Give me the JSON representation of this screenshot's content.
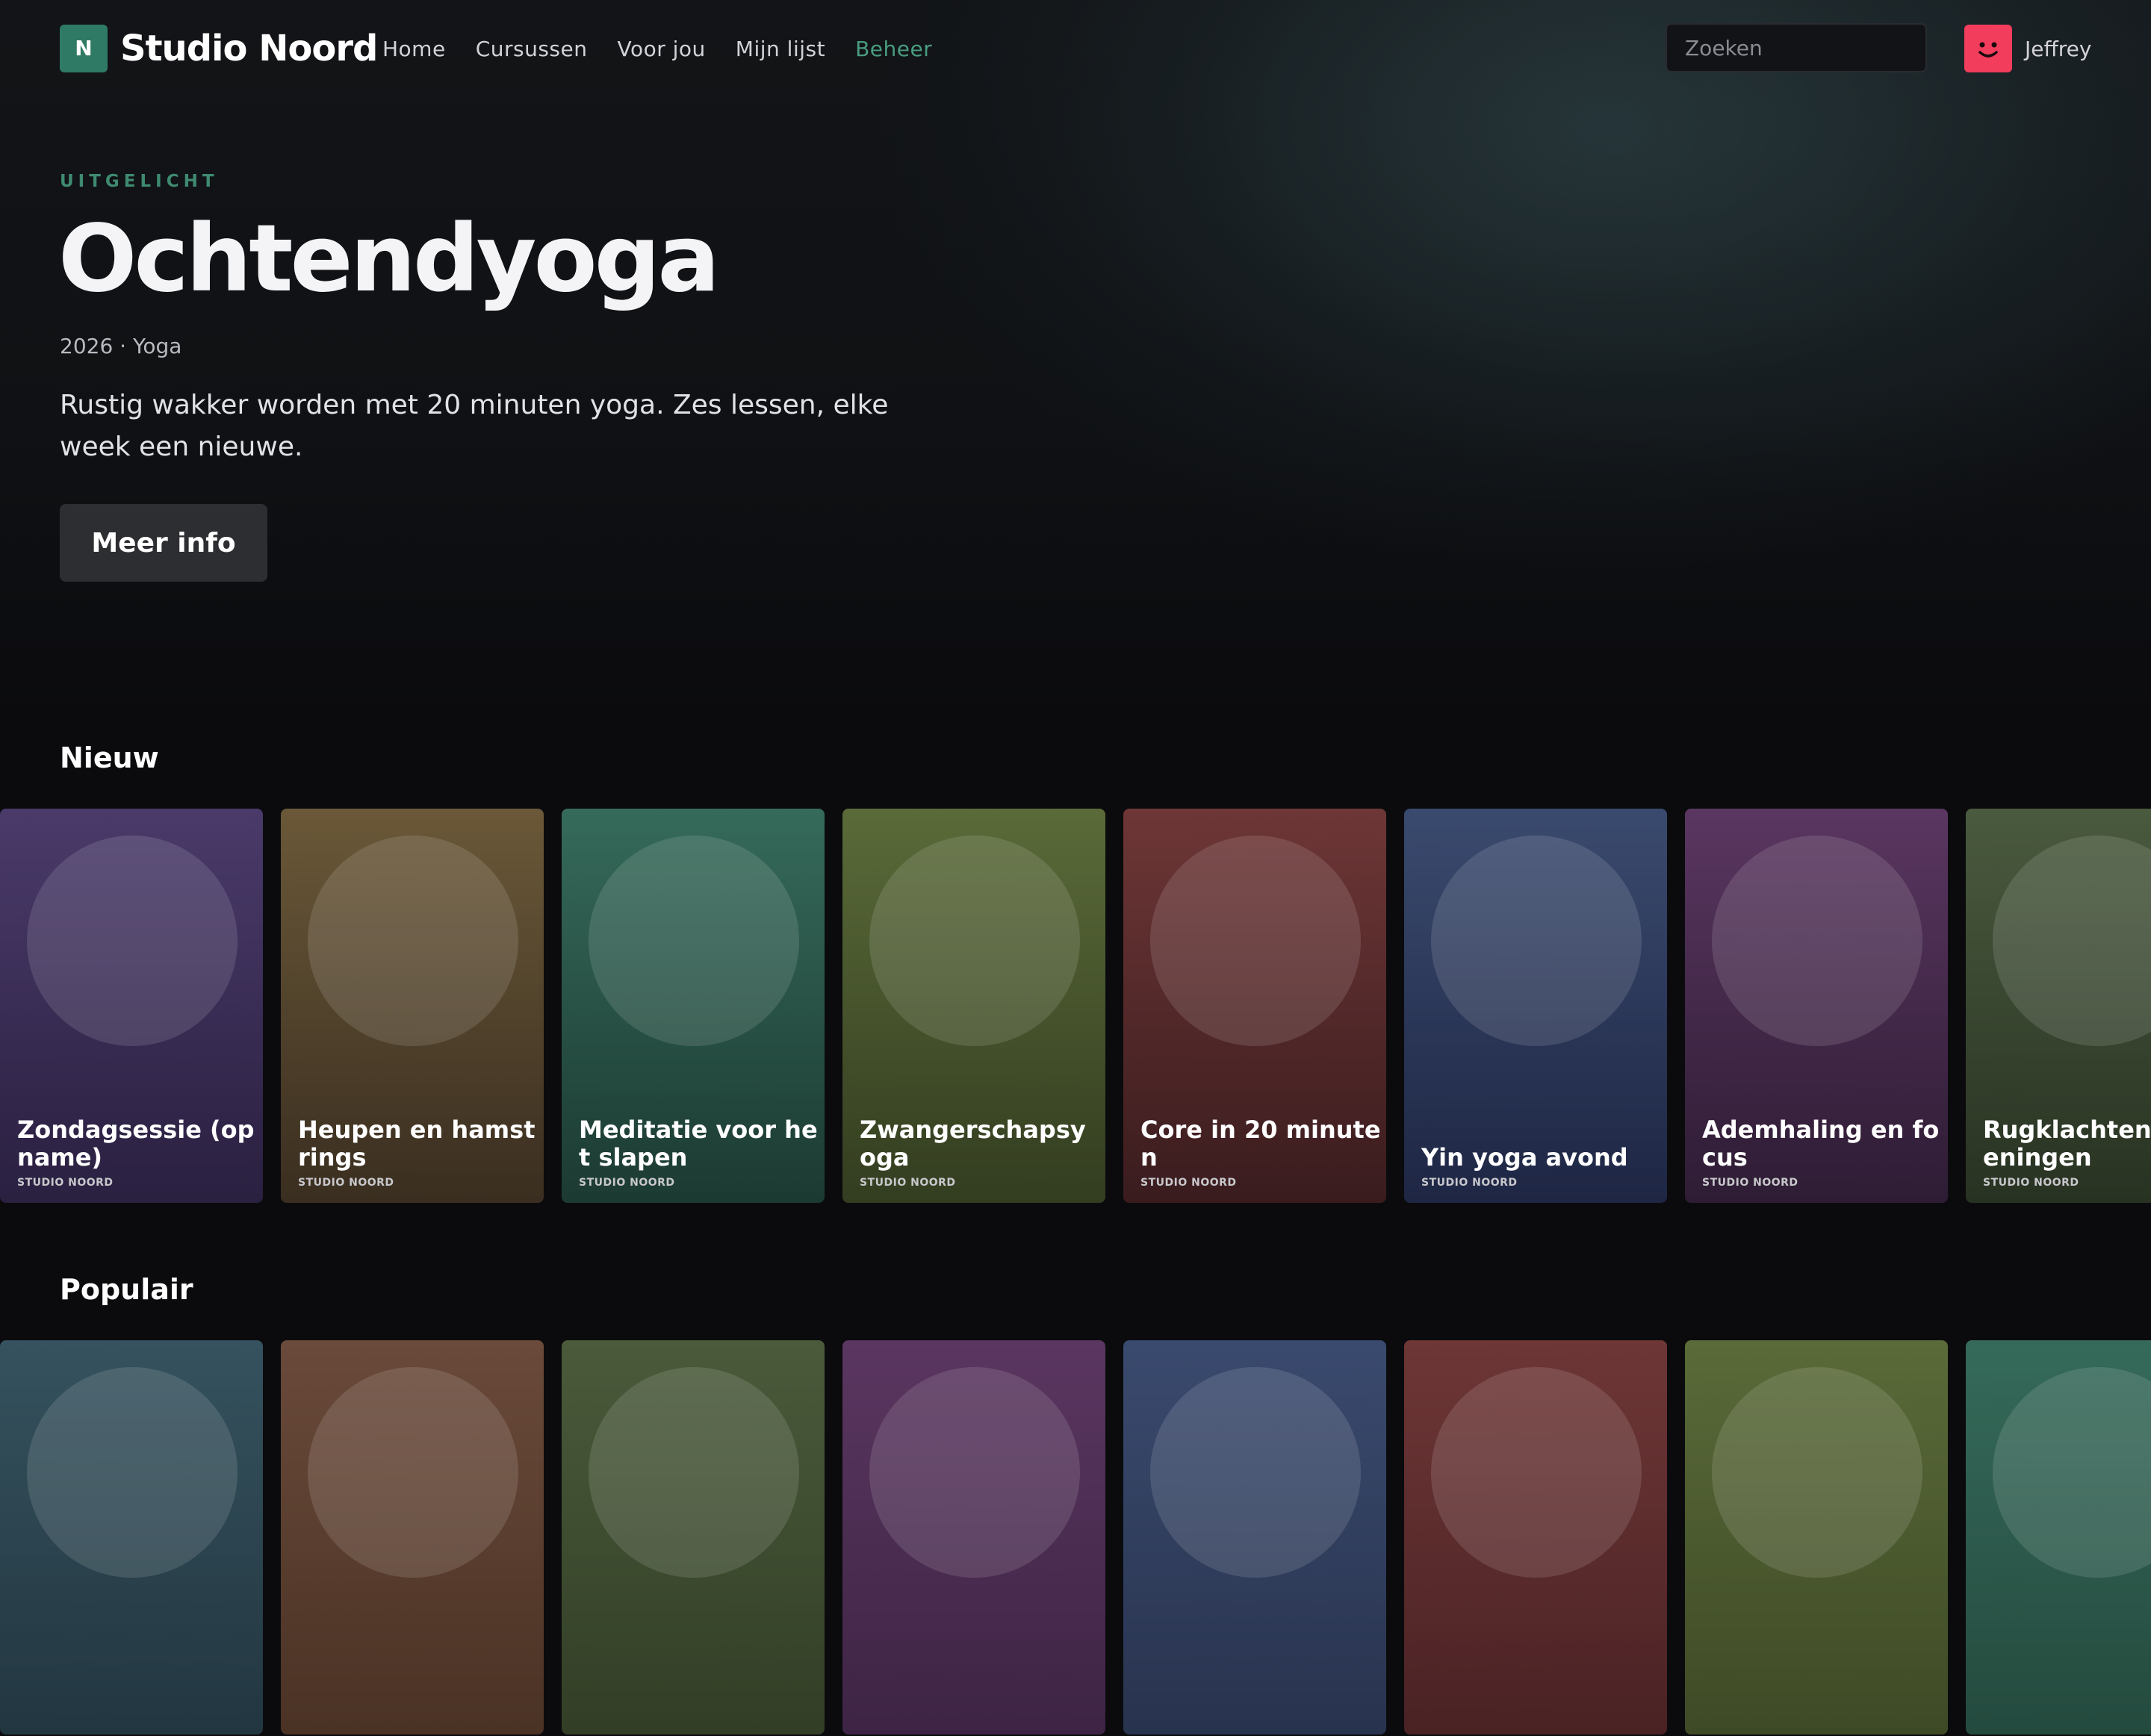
{
  "brand": {
    "logo_letter": "N",
    "name": "Studio Noord",
    "accent": "#2f7a64"
  },
  "nav": {
    "items": [
      {
        "label": "Home"
      },
      {
        "label": "Cursussen"
      },
      {
        "label": "Voor jou"
      },
      {
        "label": "Mijn lijst"
      },
      {
        "label": "Beheer",
        "active": true
      }
    ]
  },
  "search": {
    "placeholder": "Zoeken",
    "value": ""
  },
  "user": {
    "name": "Jeffrey",
    "avatar_icon": "smiley-face-icon",
    "avatar_color": "#f23d5c"
  },
  "hero": {
    "eyebrow": "UITGELICHT",
    "title": "Ochtendyoga",
    "meta": "2026 · Yoga",
    "description": "Rustig wakker worden met 20 minuten yoga. Zes lessen, elke week een nieuwe.",
    "button_label": "Meer info"
  },
  "rows": [
    {
      "title": "Nieuw",
      "cards": [
        {
          "title": "Zondagsessie (opname)",
          "subtitle": "STUDIO NOORD",
          "colors": [
            "#4a3a6a",
            "#2a2040"
          ]
        },
        {
          "title": "Heupen en hamstrings",
          "subtitle": "STUDIO NOORD",
          "colors": [
            "#6a5838",
            "#3a2e20"
          ]
        },
        {
          "title": "Meditatie voor het slapen",
          "subtitle": "STUDIO NOORD",
          "colors": [
            "#356a5a",
            "#1c3a32"
          ]
        },
        {
          "title": "Zwangerschapsyoga",
          "subtitle": "STUDIO NOORD",
          "colors": [
            "#5a6a38",
            "#333d20"
          ]
        },
        {
          "title": "Core in 20 minuten",
          "subtitle": "STUDIO NOORD",
          "colors": [
            "#6e3636",
            "#3a1c1e"
          ]
        },
        {
          "title": "Yin yoga avond",
          "subtitle": "STUDIO NOORD",
          "colors": [
            "#3a4a6e",
            "#1e2644"
          ]
        },
        {
          "title": "Ademhaling en focus",
          "subtitle": "STUDIO NOORD",
          "colors": [
            "#5a3660",
            "#2e1c34"
          ]
        },
        {
          "title": "Rugklachten: oefeningen",
          "subtitle": "STUDIO NOORD",
          "colors": [
            "#4a5a3e",
            "#283222"
          ]
        }
      ]
    },
    {
      "title": "Populair",
      "cards": [
        {
          "title": "",
          "subtitle": "",
          "colors": [
            "#35525e",
            "#223640"
          ]
        },
        {
          "title": "",
          "subtitle": "",
          "colors": [
            "#6a4a3a",
            "#4a3224"
          ]
        },
        {
          "title": "",
          "subtitle": "",
          "colors": [
            "#4a5a3a",
            "#323e26"
          ]
        },
        {
          "title": "",
          "subtitle": "",
          "colors": [
            "#5a3660",
            "#3e2444"
          ]
        },
        {
          "title": "",
          "subtitle": "",
          "colors": [
            "#3a4a6e",
            "#28334e"
          ]
        },
        {
          "title": "",
          "subtitle": "",
          "colors": [
            "#6e3636",
            "#4a2224"
          ]
        },
        {
          "title": "",
          "subtitle": "",
          "colors": [
            "#5a6a38",
            "#3e4a26"
          ]
        },
        {
          "title": "",
          "subtitle": "",
          "colors": [
            "#356a5a",
            "#244a3e"
          ]
        }
      ]
    }
  ]
}
